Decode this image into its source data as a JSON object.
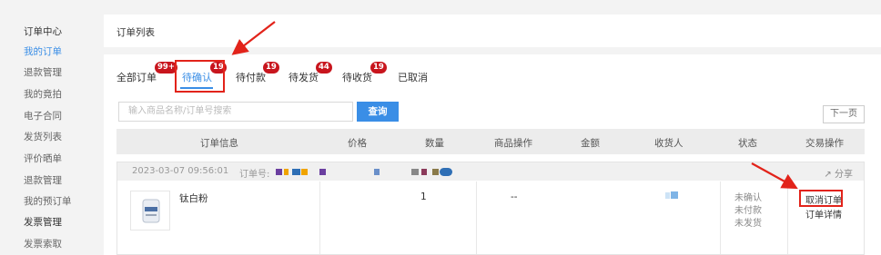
{
  "sidebar": {
    "items": [
      {
        "label": "订单中心",
        "state": "head"
      },
      {
        "label": "我的订单",
        "state": "active"
      },
      {
        "label": "退款管理",
        "state": "normal"
      },
      {
        "label": "我的竟拍",
        "state": "normal"
      },
      {
        "label": "电子合同",
        "state": "normal"
      },
      {
        "label": "发货列表",
        "state": "normal"
      },
      {
        "label": "评价晒单",
        "state": "normal"
      },
      {
        "label": "退款管理",
        "state": "normal"
      },
      {
        "label": "我的预订单",
        "state": "normal"
      },
      {
        "label": "发票管理",
        "state": "head"
      },
      {
        "label": "发票索取",
        "state": "normal"
      }
    ]
  },
  "header": {
    "title": "订单列表"
  },
  "tabs": [
    {
      "label": "全部订单",
      "badge": "99+"
    },
    {
      "label": "待确认",
      "badge": "19",
      "active": true
    },
    {
      "label": "待付款",
      "badge": "19"
    },
    {
      "label": "待发货",
      "badge": "44"
    },
    {
      "label": "待收货",
      "badge": "19"
    },
    {
      "label": "已取消",
      "badge": ""
    }
  ],
  "search": {
    "placeholder": "输入商品名称/订单号搜索",
    "button": "查询"
  },
  "pager": {
    "next": "下一页"
  },
  "table": {
    "columns": [
      "订单信息",
      "价格",
      "数量",
      "商品操作",
      "金额",
      "收货人",
      "状态",
      "交易操作"
    ]
  },
  "order": {
    "date": "2023-03-07 09:56:01",
    "number_label": "订单号:",
    "share": "分享",
    "product_name": "钛白粉",
    "quantity": "1",
    "product_ops": "--",
    "status": [
      "未确认",
      "未付款",
      "未发货"
    ],
    "cancel_label": "取消订单",
    "detail_label": "订单详情"
  },
  "colors": {
    "accent": "#3a8ee6",
    "badge": "#c8151d",
    "highlight": "#e2231a"
  }
}
